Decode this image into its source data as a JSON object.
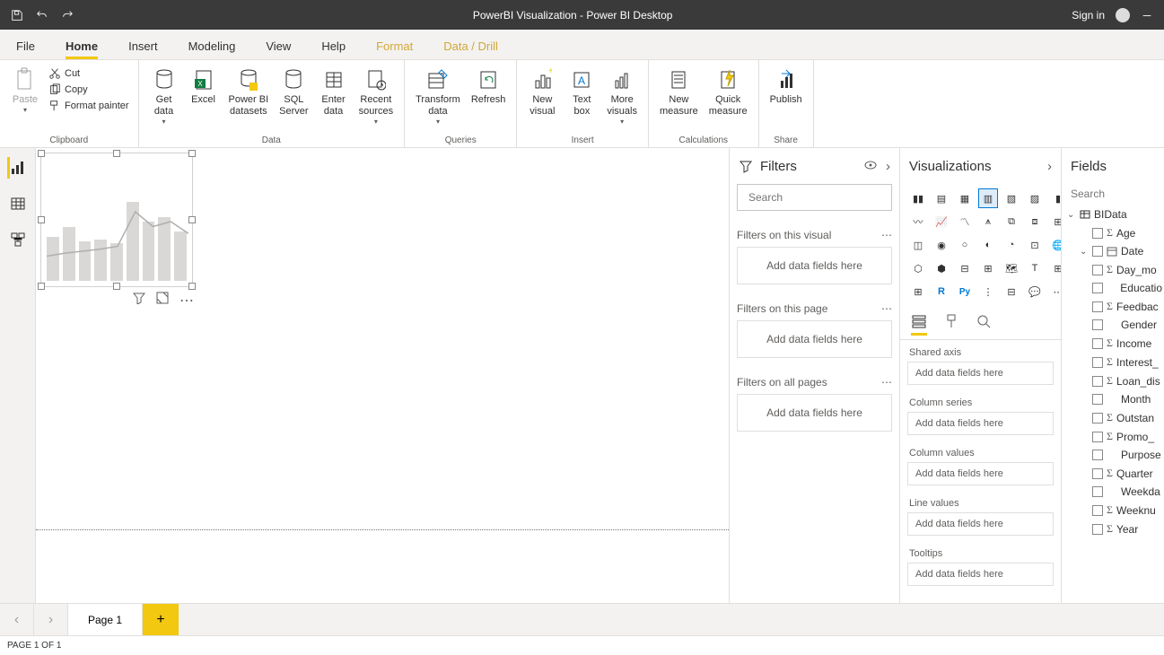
{
  "titlebar": {
    "title": "PowerBI Visualization - Power BI Desktop",
    "signin": "Sign in"
  },
  "menutabs": [
    "File",
    "Home",
    "Insert",
    "Modeling",
    "View",
    "Help",
    "Format",
    "Data / Drill"
  ],
  "ribbon": {
    "clipboard": {
      "paste": "Paste",
      "cut": "Cut",
      "copy": "Copy",
      "format_painter": "Format painter",
      "group": "Clipboard"
    },
    "data": {
      "get_data": "Get\ndata",
      "excel": "Excel",
      "pbi_datasets": "Power BI\ndatasets",
      "sql_server": "SQL\nServer",
      "enter_data": "Enter\ndata",
      "recent_sources": "Recent\nsources",
      "group": "Data"
    },
    "queries": {
      "transform": "Transform\ndata",
      "refresh": "Refresh",
      "group": "Queries"
    },
    "insert": {
      "new_visual": "New\nvisual",
      "text_box": "Text\nbox",
      "more_visuals": "More\nvisuals",
      "group": "Insert"
    },
    "calc": {
      "new_measure": "New\nmeasure",
      "quick_measure": "Quick\nmeasure",
      "group": "Calculations"
    },
    "share": {
      "publish": "Publish",
      "group": "Share"
    }
  },
  "filters": {
    "title": "Filters",
    "search_placeholder": "Search",
    "sections": [
      {
        "title": "Filters on this visual",
        "drop": "Add data fields here"
      },
      {
        "title": "Filters on this page",
        "drop": "Add data fields here"
      },
      {
        "title": "Filters on all pages",
        "drop": "Add data fields here"
      }
    ]
  },
  "viz": {
    "title": "Visualizations",
    "field_sections": [
      {
        "title": "Shared axis",
        "drop": "Add data fields here"
      },
      {
        "title": "Column series",
        "drop": "Add data fields here"
      },
      {
        "title": "Column values",
        "drop": "Add data fields here"
      },
      {
        "title": "Line values",
        "drop": "Add data fields here"
      },
      {
        "title": "Tooltips",
        "drop": "Add data fields here"
      }
    ]
  },
  "fields": {
    "title": "Fields",
    "search_placeholder": "Search",
    "table": "BIData",
    "columns": [
      {
        "name": "Age",
        "sigma": true
      },
      {
        "name": "Date",
        "calendar": true,
        "expandable": true
      },
      {
        "name": "Day_mo",
        "sigma": true
      },
      {
        "name": "Educatio",
        "sigma": false
      },
      {
        "name": "Feedbac",
        "sigma": true
      },
      {
        "name": "Gender",
        "sigma": false
      },
      {
        "name": "Income",
        "sigma": true
      },
      {
        "name": "Interest_",
        "sigma": true
      },
      {
        "name": "Loan_dis",
        "sigma": true
      },
      {
        "name": "Month",
        "sigma": false
      },
      {
        "name": "Outstan",
        "sigma": true
      },
      {
        "name": "Promo_",
        "sigma": true
      },
      {
        "name": "Purpose",
        "sigma": false
      },
      {
        "name": "Quarter",
        "sigma": true
      },
      {
        "name": "Weekda",
        "sigma": false
      },
      {
        "name": "Weeknu",
        "sigma": true
      },
      {
        "name": "Year",
        "sigma": true
      }
    ]
  },
  "pages": {
    "page1": "Page 1"
  },
  "status": "PAGE 1 OF 1",
  "chart_data": {
    "type": "bar+line",
    "bars": [
      45,
      55,
      40,
      42,
      38,
      80,
      60,
      65,
      50
    ],
    "line": [
      25,
      28,
      30,
      32,
      35,
      70,
      55,
      60,
      48
    ]
  }
}
